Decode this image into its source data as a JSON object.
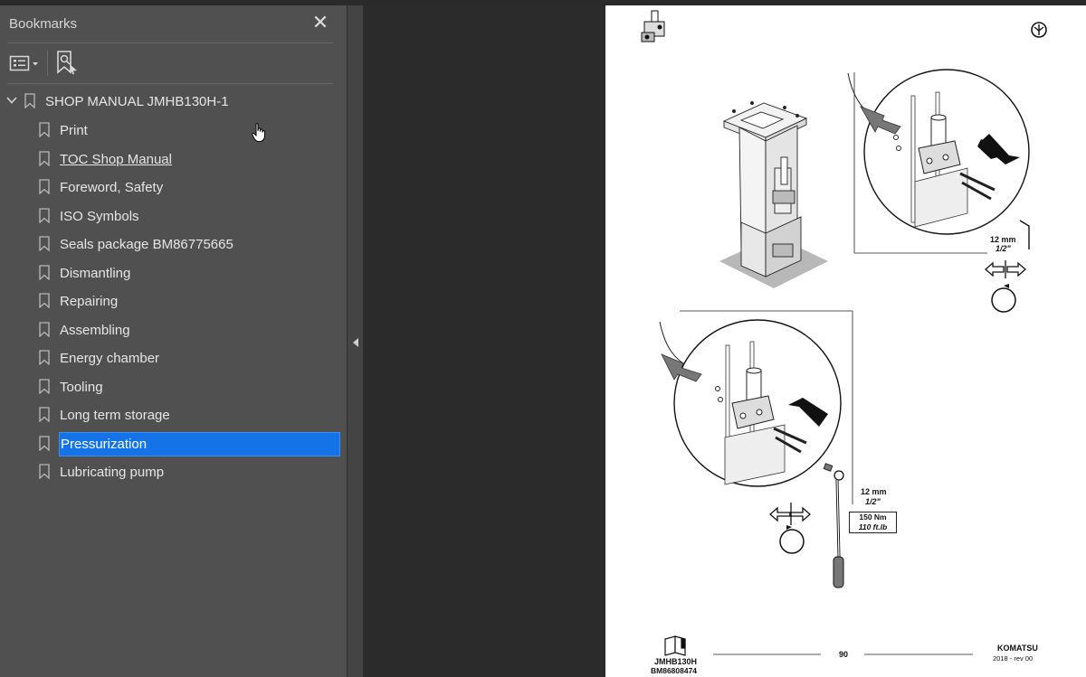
{
  "panel": {
    "title": "Bookmarks",
    "close_symbol": "✕",
    "options_icon": "list-options-icon",
    "add_bookmark_icon": "add-bookmark-icon"
  },
  "bookmarks": {
    "root": "SHOP MANUAL JMHB130H-1",
    "items": [
      "Print",
      "TOC Shop Manual",
      "Foreword, Safety",
      "ISO Symbols",
      "Seals package BM86775665",
      "Dismantling",
      "Repairing",
      "Assembling",
      "Energy chamber",
      "Tooling",
      "Long term storage",
      "Pressurization",
      "Lubricating pump"
    ],
    "selected": "Pressurization",
    "selected_color": "#1473e6"
  },
  "page": {
    "spec_top": {
      "size_mm": "12 mm",
      "size_in": "1/2\""
    },
    "spec_bottom": {
      "size_mm": "12 mm",
      "size_in": "1/2\"",
      "torque_nm": "150 Nm",
      "torque_ftlb": "110 ft.lb"
    },
    "footer": {
      "model": "JMHB130H",
      "doc_number": "BM86808474",
      "page_number": "90",
      "brand": "KOMATSU",
      "revision": "2018 -  rev 00"
    }
  }
}
